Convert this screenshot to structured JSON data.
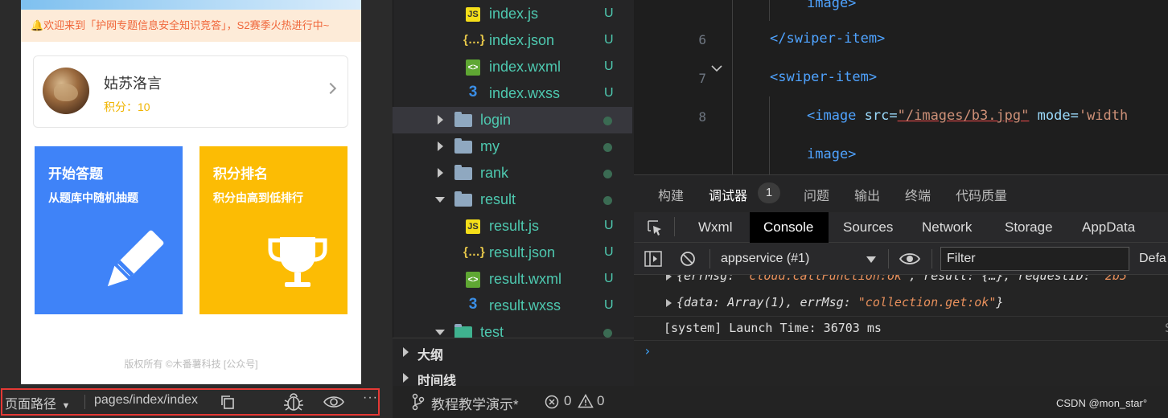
{
  "simulator": {
    "notice": "🔔欢迎来到「护网专题信息安全知识竞答」，S2赛季火热进行中~",
    "user": {
      "name": "姑苏洛言",
      "score": "积分：10"
    },
    "tiles": [
      {
        "title": "开始答题",
        "subtitle": "从题库中随机抽题",
        "color": "#3f83f8"
      },
      {
        "title": "积分排名",
        "subtitle": "积分由高到低排行",
        "color": "#fcbc04"
      }
    ],
    "copyright": "版权所有 ©木番薯科技 [公众号]",
    "toolbar": {
      "path_label": "页面路径",
      "path_value": "pages/index/index"
    }
  },
  "explorer": {
    "files": [
      {
        "label": "index.js",
        "status": "U"
      },
      {
        "label": "index.json",
        "status": "U"
      },
      {
        "label": "index.wxml",
        "status": "U"
      },
      {
        "label": "index.wxss",
        "status": "U"
      },
      {
        "label": "login"
      },
      {
        "label": "my"
      },
      {
        "label": "rank"
      },
      {
        "label": "result"
      },
      {
        "label": "result.js",
        "status": "U"
      },
      {
        "label": "result.json",
        "status": "U"
      },
      {
        "label": "result.wxml",
        "status": "U"
      },
      {
        "label": "result.wxss",
        "status": "U"
      },
      {
        "label": "test"
      }
    ],
    "outline": "大纲",
    "timeline": "时间线"
  },
  "editor": {
    "line_numbers": [
      "6",
      "7",
      "8"
    ],
    "lines": {
      "l0": "image>",
      "l1": "</swiper-item>",
      "l2": "<swiper-item>",
      "l3_tag": "<image",
      "l3_attr": "src=",
      "l3_val": "\"/images/b3.jpg\"",
      "l3_attr2": "mode=",
      "l3_val2": "'width",
      "l4": "image>"
    }
  },
  "panel": {
    "tabs": [
      "构建",
      "调试器",
      "问题",
      "输出",
      "终端",
      "代码质量"
    ],
    "debugger_badge": "1"
  },
  "devtools": {
    "tabs": [
      "Wxml",
      "Console",
      "Sources",
      "Network",
      "Storage",
      "AppData"
    ],
    "context": "appservice (#1)",
    "filter_placeholder": "Filter",
    "levels": "Defa"
  },
  "console": {
    "line1_a": "{errMsg: ",
    "line1_b": "\"cloud.callFunction:ok\"",
    "line1_c": ", result: {…}, requestID: ",
    "line1_d": "\"2b5",
    "line2_a": "{data: Array(1), errMsg: ",
    "line2_b": "\"collection.get:ok\"",
    "line2_c": "}",
    "line3": "[system] Launch Time: 36703 ms",
    "line3_right": "S"
  },
  "statusbar": {
    "branch": "教程教学演示*",
    "errors": "0",
    "warnings": "0",
    "watermark": "CSDN @mon_star°"
  }
}
